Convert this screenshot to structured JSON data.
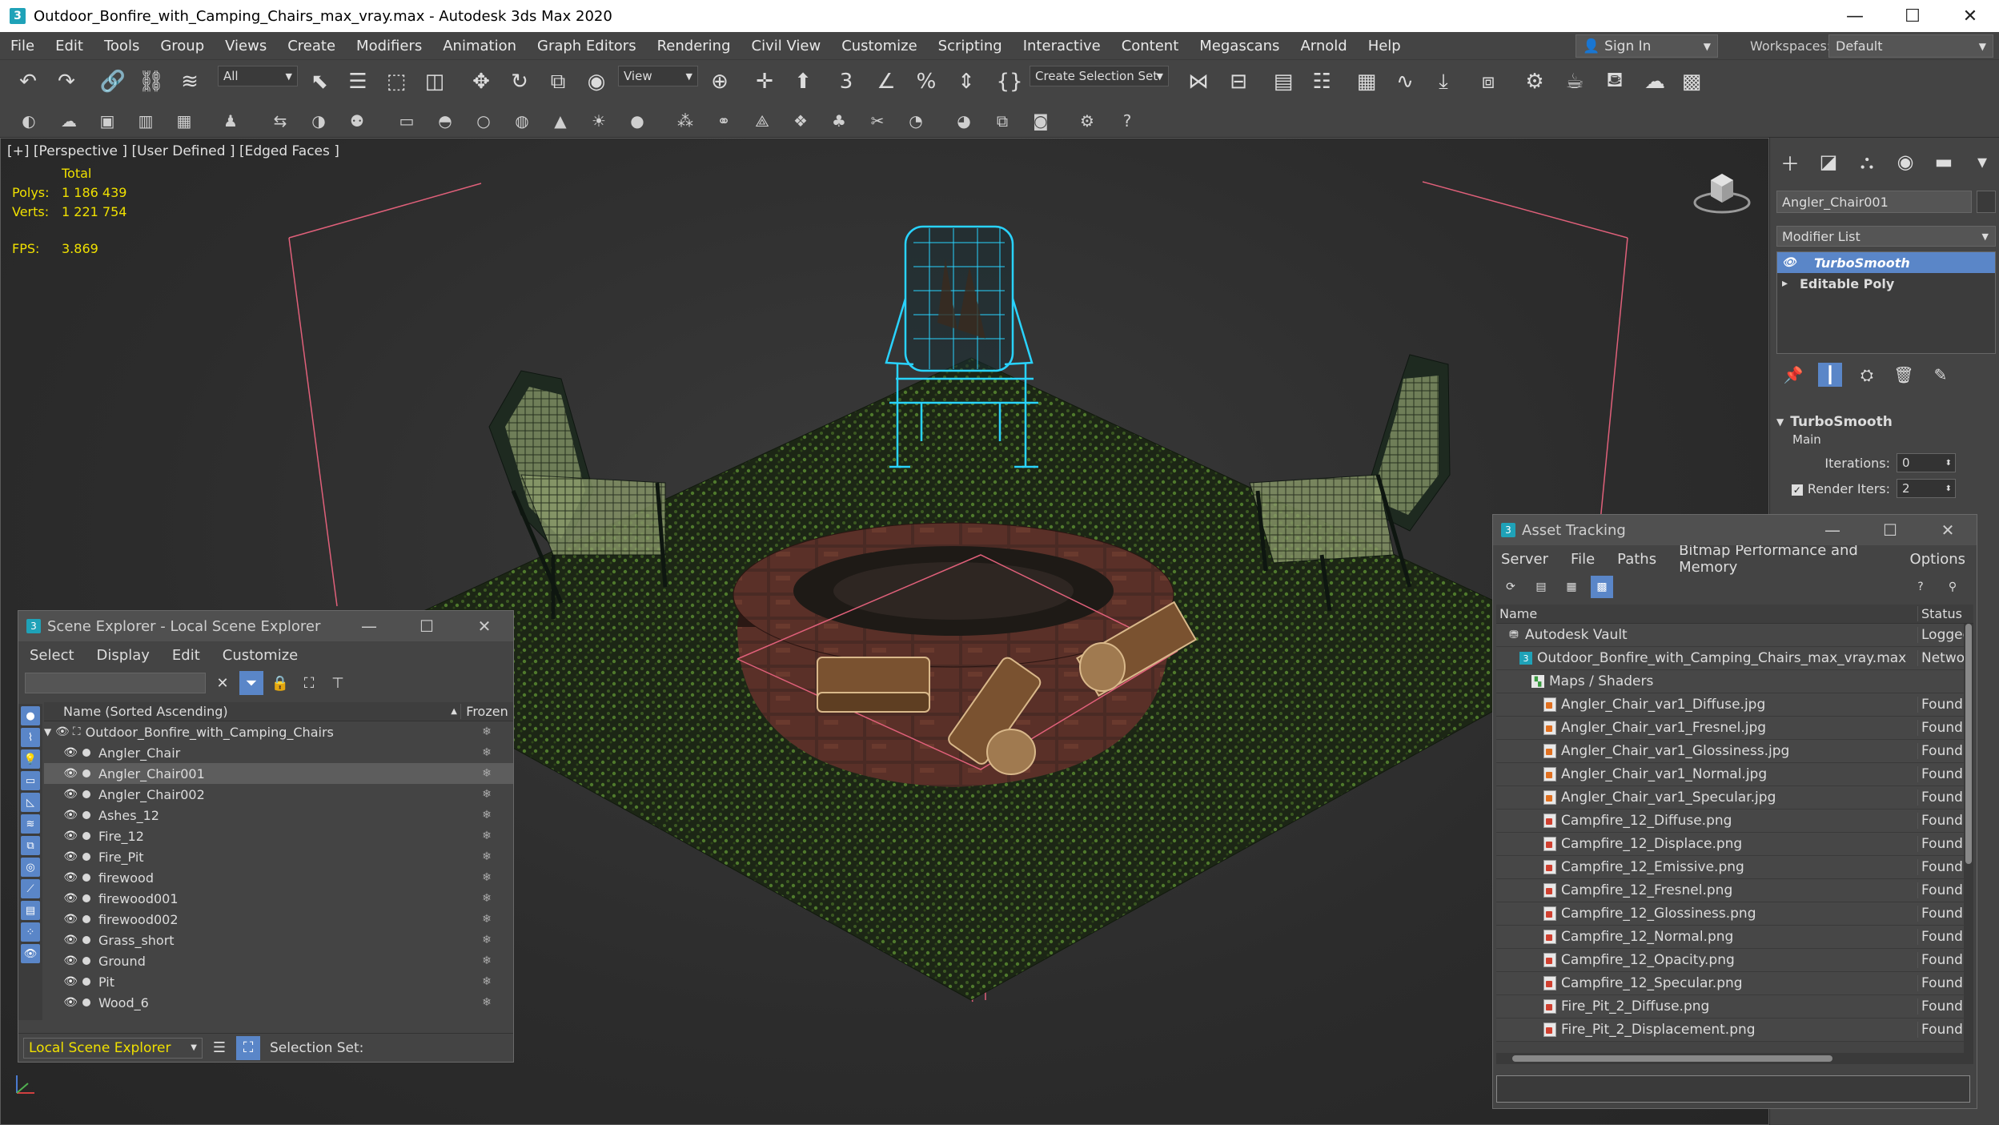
{
  "window": {
    "title": "Outdoor_Bonfire_with_Camping_Chairs_max_vray.max - Autodesk 3ds Max 2020",
    "app_icon": "3",
    "controls": [
      "—",
      "☐",
      "✕"
    ]
  },
  "menu": [
    "File",
    "Edit",
    "Tools",
    "Group",
    "Views",
    "Create",
    "Modifiers",
    "Animation",
    "Graph Editors",
    "Rendering",
    "Civil View",
    "Customize",
    "Scripting",
    "Interactive",
    "Content",
    "Megascans",
    "Arnold",
    "Help"
  ],
  "account": {
    "sign_in": "Sign In",
    "workspaces_label": "Workspaces:",
    "workspace": "Default"
  },
  "toolbar": {
    "selection_filter": "All",
    "reference_coord": "View",
    "selection_set": "Create Selection Set"
  },
  "viewport": {
    "label": "[+] [Perspective ] [User Defined ] [Edged Faces ]",
    "stats_header": "Total",
    "polys_label": "Polys:",
    "polys_value": "1 186 439",
    "verts_label": "Verts:",
    "verts_value": "1 221 754",
    "fps_label": "FPS:",
    "fps_value": "3.869",
    "accent_selection": "#29d3ff",
    "accent_bbox": "#e0607a"
  },
  "command_panel": {
    "object_name": "Angler_Chair001",
    "modifier_list": "Modifier List",
    "stack": [
      {
        "name": "TurboSmooth",
        "selected": true
      },
      {
        "name": "Editable Poly",
        "selected": false
      }
    ],
    "rollout_title": "TurboSmooth",
    "rollout_section": "Main",
    "iterations_label": "Iterations:",
    "iterations_value": "0",
    "render_iters_label": "Render Iters:",
    "render_iters_value": "2"
  },
  "scene_explorer": {
    "title": "Scene Explorer - Local Scene Explorer",
    "menu": [
      "Select",
      "Display",
      "Edit",
      "Customize"
    ],
    "col_name": "Name (Sorted Ascending)",
    "col_frozen": "Frozen",
    "root": "Outdoor_Bonfire_with_Camping_Chairs",
    "items": [
      {
        "name": "Angler_Chair",
        "selected": false
      },
      {
        "name": "Angler_Chair001",
        "selected": true
      },
      {
        "name": "Angler_Chair002",
        "selected": false
      },
      {
        "name": "Ashes_12",
        "selected": false
      },
      {
        "name": "Fire_12",
        "selected": false
      },
      {
        "name": "Fire_Pit",
        "selected": false
      },
      {
        "name": "firewood",
        "selected": false
      },
      {
        "name": "firewood001",
        "selected": false
      },
      {
        "name": "firewood002",
        "selected": false
      },
      {
        "name": "Grass_short",
        "selected": false
      },
      {
        "name": "Ground",
        "selected": false
      },
      {
        "name": "Pit",
        "selected": false
      },
      {
        "name": "Wood_6",
        "selected": false
      }
    ],
    "mode": "Local Scene Explorer",
    "selection_set_label": "Selection Set:"
  },
  "asset_tracking": {
    "title": "Asset Tracking",
    "menu": [
      "Server",
      "File",
      "Paths",
      "Bitmap Performance and Memory",
      "Options"
    ],
    "col_name": "Name",
    "col_status": "Status",
    "rows": [
      {
        "name": "Autodesk Vault",
        "status": "Logged.",
        "level": 0,
        "kind": "vault"
      },
      {
        "name": "Outdoor_Bonfire_with_Camping_Chairs_max_vray.max",
        "status": "Networ...",
        "level": 1,
        "kind": "max"
      },
      {
        "name": "Maps / Shaders",
        "status": "",
        "level": 2,
        "kind": "folder"
      },
      {
        "name": "Angler_Chair_var1_Diffuse.jpg",
        "status": "Found",
        "level": 3,
        "kind": "jpg"
      },
      {
        "name": "Angler_Chair_var1_Fresnel.jpg",
        "status": "Found",
        "level": 3,
        "kind": "jpg"
      },
      {
        "name": "Angler_Chair_var1_Glossiness.jpg",
        "status": "Found",
        "level": 3,
        "kind": "jpg"
      },
      {
        "name": "Angler_Chair_var1_Normal.jpg",
        "status": "Found",
        "level": 3,
        "kind": "jpg"
      },
      {
        "name": "Angler_Chair_var1_Specular.jpg",
        "status": "Found",
        "level": 3,
        "kind": "jpg"
      },
      {
        "name": "Campfire_12_Diffuse.png",
        "status": "Found",
        "level": 3,
        "kind": "png"
      },
      {
        "name": "Campfire_12_Displace.png",
        "status": "Found",
        "level": 3,
        "kind": "png"
      },
      {
        "name": "Campfire_12_Emissive.png",
        "status": "Found",
        "level": 3,
        "kind": "png"
      },
      {
        "name": "Campfire_12_Fresnel.png",
        "status": "Found",
        "level": 3,
        "kind": "png"
      },
      {
        "name": "Campfire_12_Glossiness.png",
        "status": "Found",
        "level": 3,
        "kind": "png"
      },
      {
        "name": "Campfire_12_Normal.png",
        "status": "Found",
        "level": 3,
        "kind": "png"
      },
      {
        "name": "Campfire_12_Opacity.png",
        "status": "Found",
        "level": 3,
        "kind": "png"
      },
      {
        "name": "Campfire_12_Specular.png",
        "status": "Found",
        "level": 3,
        "kind": "png"
      },
      {
        "name": "Fire_Pit_2_Diffuse.png",
        "status": "Found",
        "level": 3,
        "kind": "png"
      },
      {
        "name": "Fire_Pit_2_Displacement.png",
        "status": "Found",
        "level": 3,
        "kind": "png"
      }
    ]
  }
}
